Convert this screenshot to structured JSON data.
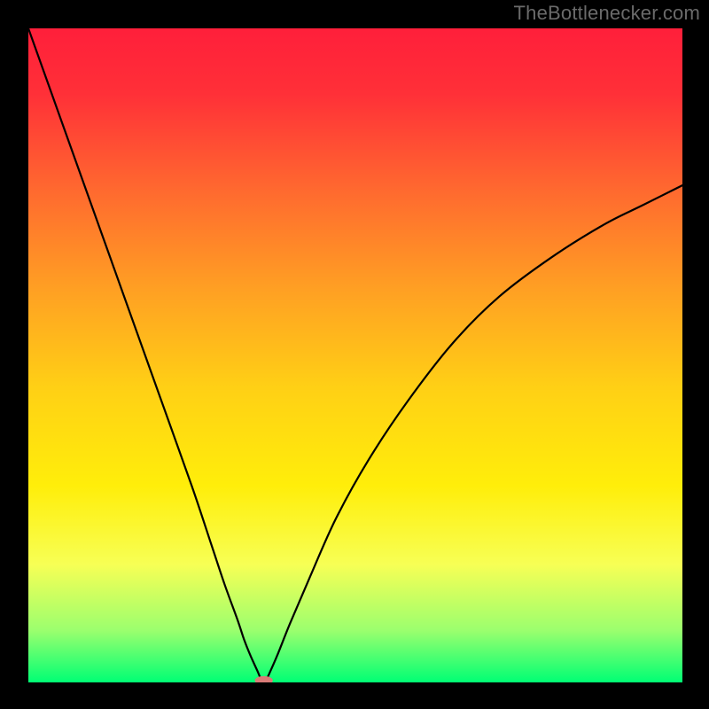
{
  "watermark": "TheBottlenecker.com",
  "colors": {
    "black": "#000000",
    "curve": "#000000",
    "marker_fill": "#d97b77",
    "marker_stroke": "#d97b77"
  },
  "chart_data": {
    "type": "line",
    "title": "",
    "xlabel": "",
    "ylabel": "",
    "xlim": [
      0,
      100
    ],
    "ylim": [
      0,
      100
    ],
    "grid": false,
    "legend": false,
    "gradient_stops": [
      {
        "offset": 0.0,
        "color": "#ff1f3a"
      },
      {
        "offset": 0.1,
        "color": "#ff3038"
      },
      {
        "offset": 0.25,
        "color": "#ff6a2f"
      },
      {
        "offset": 0.4,
        "color": "#ffa023"
      },
      {
        "offset": 0.55,
        "color": "#ffd015"
      },
      {
        "offset": 0.7,
        "color": "#ffee0a"
      },
      {
        "offset": 0.82,
        "color": "#f7ff55"
      },
      {
        "offset": 0.92,
        "color": "#9cff6e"
      },
      {
        "offset": 1.0,
        "color": "#00ff74"
      }
    ],
    "series": [
      {
        "name": "bottleneck-curve-left",
        "x": [
          0,
          5,
          10,
          15,
          20,
          25,
          28,
          30,
          32,
          33,
          34,
          35,
          35.5
        ],
        "y": [
          100,
          86,
          72,
          58,
          44,
          30,
          21,
          15,
          9.5,
          6.5,
          4.0,
          1.8,
          0.6
        ]
      },
      {
        "name": "bottleneck-curve-right",
        "x": [
          36.5,
          38,
          40,
          43,
          47,
          52,
          58,
          65,
          72,
          80,
          88,
          94,
          100
        ],
        "y": [
          0.6,
          4.0,
          9.0,
          16,
          25,
          34,
          43,
          52,
          59,
          65,
          70,
          73,
          76
        ]
      }
    ],
    "marker": {
      "name": "min-point",
      "cx": 36.0,
      "cy": 0.3,
      "rx": 1.3,
      "ry": 0.6
    }
  }
}
